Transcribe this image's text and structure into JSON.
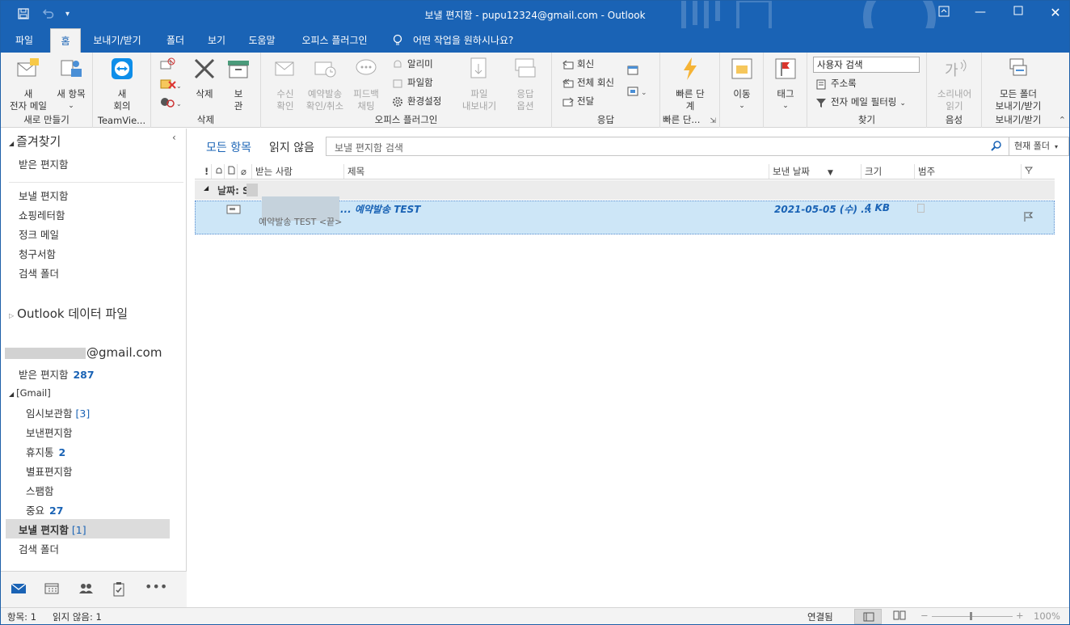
{
  "window": {
    "title": "보낼 편지함 - pupu12324@gmail.com  -  Outlook"
  },
  "tabs": [
    "파일",
    "홈",
    "보내기/받기",
    "폴더",
    "보기",
    "도움말",
    "오피스 플러그인"
  ],
  "tell_me": "어떤 작업을 원하시나요?",
  "ribbon": {
    "new_mail": "새\n전자 메일",
    "new_items": "새 항목",
    "new_group": "새로 만들기",
    "new_meeting": "새\n회의",
    "teamviewer_group": "TeamVie...",
    "delete": "삭제",
    "archive": "보\n관",
    "delete_group": "삭제",
    "read_receipt": "수신\n확인",
    "schedule_send": "예약발송\n확인/취소",
    "feedback_chat": "피드백\n채팅",
    "notify": "알리미",
    "attachment": "파일함",
    "settings": "환경설정",
    "file_export": "파일\n내보내기",
    "reply_options": "응답\n옵션",
    "plugin_group": "오피스 플러그인",
    "reply": "회신",
    "reply_all": "전체 회신",
    "forward": "전달",
    "respond_group": "응답",
    "quick_steps": "빠른 단\n계",
    "quick_group": "빠른 단...",
    "move": "이동",
    "tags": "태그",
    "search_people": "사용자 검색",
    "address_book": "주소록",
    "filter_email": "전자 메일 필터링",
    "find_group": "찾기",
    "read_aloud": "소리내어\n읽기",
    "voice_group": "음성",
    "send_receive_all": "모든 폴더\n보내기/받기",
    "send_receive_group": "보내기/받기"
  },
  "folders": {
    "favorites_header": "즐겨찾기",
    "fav_inbox": "받은 편지함",
    "sent": "보낼 편지함",
    "shopping": "쇼핑레터함",
    "junk": "정크 메일",
    "bills": "청구서함",
    "search": "검색 폴더",
    "data_file": "Outlook 데이터 파일",
    "account": "@gmail.com",
    "acc_inbox": "받은 편지함",
    "acc_inbox_count": "287",
    "gmail": "[Gmail]",
    "drafts": "임시보관함",
    "drafts_count": "[3]",
    "sent_mail": "보낸편지함",
    "trash": "휴지통",
    "trash_count": "2",
    "starred": "별표편지함",
    "spam": "스팸함",
    "important": "중요",
    "important_count": "27",
    "outbox": "보낼 편지함",
    "outbox_count": "[1]",
    "search_folder": "검색 폴더"
  },
  "view": {
    "all": "모든 항목",
    "unread": "읽지 않음",
    "search_placeholder": "보낼 편지함 검색",
    "scope": "현재 폴더"
  },
  "columns": {
    "to": "받는 사람",
    "subject": "제목",
    "sent_date": "보낸 날짜",
    "size": "크기",
    "category": "범주"
  },
  "group_header": "날짜: S",
  "message": {
    "subject": "... 예약발송 TEST",
    "preview": "예약발송 TEST <끝>",
    "date": "2021-05-05 (수) ...",
    "size": "4 KB"
  },
  "status": {
    "items": "항목: 1",
    "unread": "읽지 않음: 1",
    "connected": "연결됨",
    "zoom": "100%"
  }
}
